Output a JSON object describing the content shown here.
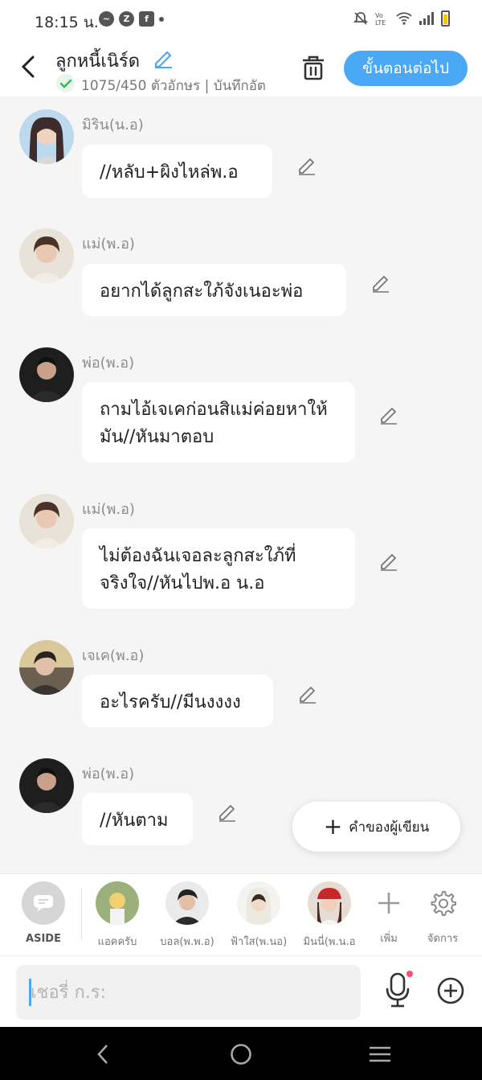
{
  "status_bar": {
    "time": "18:15 น.",
    "app_icons": [
      "messenger-icon",
      "nfc-icon",
      "facebook-icon"
    ],
    "right_icons": [
      "mute-icon",
      "volte-icon",
      "wifi-icon",
      "signal-icon",
      "battery-icon"
    ]
  },
  "header": {
    "title": "ลูกหนี้เนิร์ด",
    "counter": "1075/450 ตัวอักษร | บันทึกอัต",
    "next_label": "ขั้นตอนต่อไป"
  },
  "messages": [
    {
      "speaker": "มิริน(น.อ)",
      "text": "//หลับ+ผิงไหล่พ.อ"
    },
    {
      "speaker": "แม่(พ.อ)",
      "text": "อยากได้ลูกสะใภ้จังเนอะพ่อ"
    },
    {
      "speaker": "พ่อ(พ.อ)",
      "text": "ถามไอ้เจเคก่อนสิแม่ค่อยหาให้มัน//หันมาตอบ"
    },
    {
      "speaker": "แม่(พ.อ)",
      "text": "ไม่ต้องฉันเจอละลูกสะใภ้ที่จริงใจ//หันไปพ.อ น.อ"
    },
    {
      "speaker": "เจเค(พ.อ)",
      "text": "อะไรครับ//มีนงงงง"
    },
    {
      "speaker": "พ่อ(พ.อ)",
      "text": "//หันตาม"
    }
  ],
  "author_button": {
    "label": "คำของผู้เขียน"
  },
  "character_bar": {
    "aside_label": "ASIDE",
    "characters": [
      "แอคครับ",
      "บอล(พ.พ.อ)",
      "ฟ้าใส(พ.นอ)",
      "มินนี่(พ.น.อ"
    ],
    "add_label": "เพิ่ม",
    "manage_label": "จัดการ"
  },
  "input": {
    "placeholder": "เชอรี่ ก.ร:"
  }
}
